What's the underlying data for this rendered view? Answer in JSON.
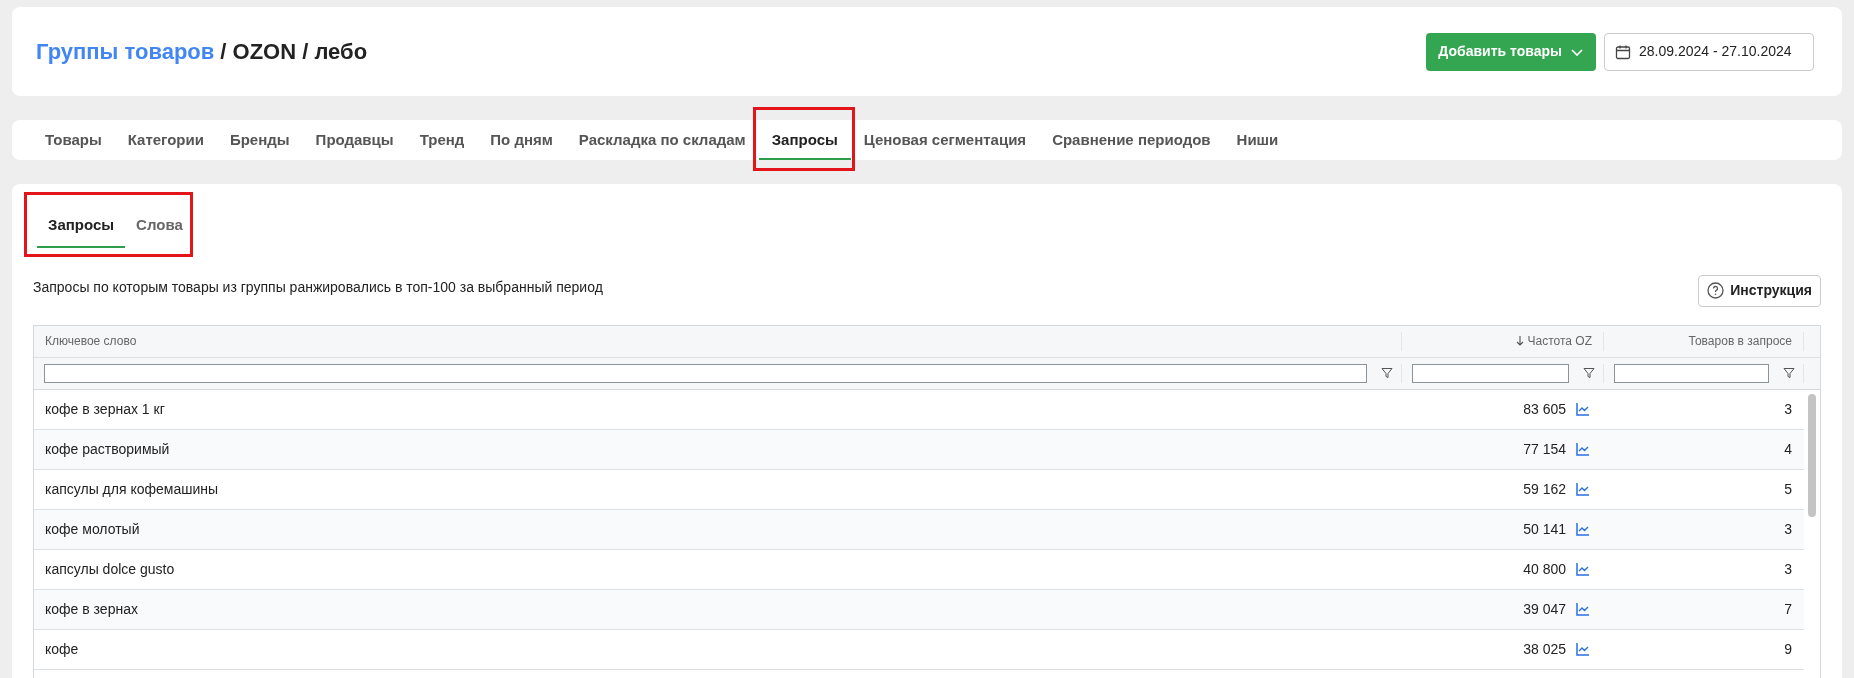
{
  "header": {
    "breadcrumb": [
      {
        "label": "Группы товаров",
        "kind": "link"
      },
      {
        "label": "/ OZON / лебо",
        "kind": "current"
      }
    ],
    "add_button": "Добавить товары",
    "date_range": "28.09.2024 - 27.10.2024"
  },
  "tabs": [
    {
      "label": "Товары",
      "selected": false,
      "highlighted": false
    },
    {
      "label": "Категории",
      "selected": false,
      "highlighted": false
    },
    {
      "label": "Бренды",
      "selected": false,
      "highlighted": false
    },
    {
      "label": "Продавцы",
      "selected": false,
      "highlighted": false
    },
    {
      "label": "Тренд",
      "selected": false,
      "highlighted": false
    },
    {
      "label": "По дням",
      "selected": false,
      "highlighted": false
    },
    {
      "label": "Раскладка по складам",
      "selected": false,
      "highlighted": false
    },
    {
      "label": "Запросы",
      "selected": true,
      "highlighted": true
    },
    {
      "label": "Ценовая сегментация",
      "selected": false,
      "highlighted": false
    },
    {
      "label": "Сравнение периодов",
      "selected": false,
      "highlighted": false
    },
    {
      "label": "Ниши",
      "selected": false,
      "highlighted": false
    }
  ],
  "subtabs": [
    {
      "label": "Запросы",
      "selected": true
    },
    {
      "label": "Слова",
      "selected": false
    }
  ],
  "description": "Запросы по которым товары из группы ранжировались в топ-100 за выбранный период",
  "help_button": "Инструкция",
  "table": {
    "columns": [
      {
        "label": "Ключевое слово",
        "sorted": false
      },
      {
        "label": "Частота OZ",
        "sorted": true
      },
      {
        "label": "Товаров в запросе",
        "sorted": false
      }
    ],
    "rows": [
      {
        "keyword": "кофе в зернах 1 кг",
        "frequency": "83 605",
        "products": "3"
      },
      {
        "keyword": "кофе растворимый",
        "frequency": "77 154",
        "products": "4"
      },
      {
        "keyword": "капсулы для кофемашины",
        "frequency": "59 162",
        "products": "5"
      },
      {
        "keyword": "кофе молотый",
        "frequency": "50 141",
        "products": "3"
      },
      {
        "keyword": "капсулы dolce gusto",
        "frequency": "40 800",
        "products": "3"
      },
      {
        "keyword": "кофе в зернах",
        "frequency": "39 047",
        "products": "7"
      },
      {
        "keyword": "кофе",
        "frequency": "38 025",
        "products": "9"
      }
    ]
  }
}
